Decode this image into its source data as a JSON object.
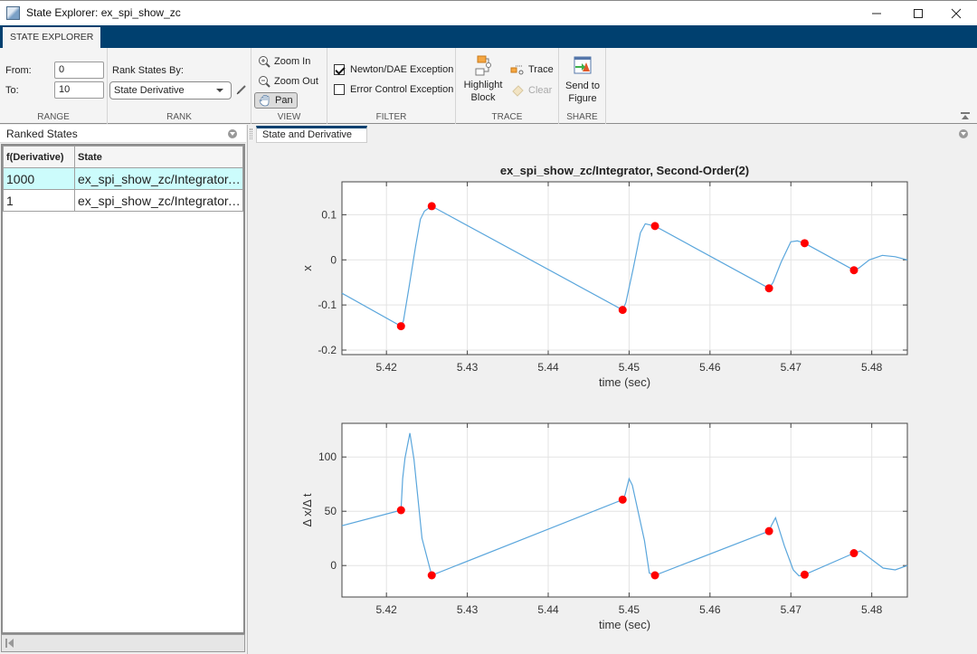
{
  "window": {
    "title": "State Explorer: ex_spi_show_zc",
    "controls": [
      "minimize",
      "maximize",
      "close"
    ]
  },
  "ribbon": {
    "tab_label": "STATE EXPLORER",
    "range": {
      "section_label": "RANGE",
      "from_label": "From:",
      "from_value": "0",
      "to_label": "To:",
      "to_value": "10"
    },
    "rank": {
      "section_label": "RANK",
      "rank_by_label": "Rank States By:",
      "rank_by_value": "State Derivative"
    },
    "view": {
      "section_label": "VIEW",
      "zoom_in": "Zoom In",
      "zoom_out": "Zoom Out",
      "pan": "Pan",
      "pan_active": true
    },
    "filter": {
      "section_label": "FILTER",
      "newton_dae": "Newton/DAE Exception",
      "newton_dae_checked": true,
      "error_control": "Error Control Exception",
      "error_control_checked": false
    },
    "trace": {
      "section_label": "TRACE",
      "highlight_line1": "Highlight",
      "highlight_line2": "Block",
      "trace": "Trace",
      "clear": "Clear"
    },
    "share": {
      "section_label": "SHARE",
      "send_line1": "Send to",
      "send_line2": "Figure"
    }
  },
  "left_panel": {
    "title": "Ranked States",
    "columns": [
      "f(Derivative)",
      "State"
    ],
    "rows": [
      {
        "value": "1000",
        "state": "ex_spi_show_zc/Integrator,…",
        "selected": true
      },
      {
        "value": "1",
        "state": "ex_spi_show_zc/Integrator,…",
        "selected": false
      }
    ]
  },
  "right_panel": {
    "tab_label": "State and Derivative"
  },
  "chart_data": [
    {
      "type": "line",
      "title": "ex_spi_show_zc/Integrator,  Second-Order(2)",
      "xlabel": "time (sec)",
      "ylabel": "x",
      "xlim": [
        5.4145,
        5.4844
      ],
      "ylim": [
        -0.21,
        0.173
      ],
      "xticks": [
        5.42,
        5.43,
        5.44,
        5.45,
        5.46,
        5.47,
        5.48
      ],
      "xtick_labels": [
        "5.42",
        "5.43",
        "5.44",
        "5.45",
        "5.46",
        "5.47",
        "5.48"
      ],
      "yticks": [
        -0.2,
        -0.1,
        0,
        0.1
      ],
      "ytick_labels": [
        "-0.2",
        "-0.1",
        "0",
        "0.1"
      ],
      "grid": true,
      "line_color": "#5aa6dc",
      "marker_color": "#ff0000",
      "series": [
        {
          "name": "state",
          "x": [
            5.4145,
            5.4218,
            5.4221,
            5.4228,
            5.4236,
            5.4242,
            5.4247,
            5.4256,
            5.4492,
            5.4496,
            5.4505,
            5.4514,
            5.452,
            5.4532,
            5.4673,
            5.4678,
            5.4688,
            5.47,
            5.4708,
            5.4717,
            5.4778,
            5.4784,
            5.4797,
            5.4813,
            5.4829,
            5.4844
          ],
          "y": [
            -0.074,
            -0.147,
            -0.135,
            -0.06,
            0.03,
            0.09,
            0.108,
            0.119,
            -0.111,
            -0.095,
            -0.02,
            0.06,
            0.08,
            0.075,
            -0.063,
            -0.05,
            -0.005,
            0.04,
            0.042,
            0.037,
            -0.023,
            -0.018,
            0.0,
            0.01,
            0.007,
            0.0
          ]
        },
        {
          "name": "exceptions",
          "x": [
            5.4218,
            5.4256,
            5.4492,
            5.4532,
            5.4673,
            5.4717,
            5.4778
          ],
          "y": [
            -0.147,
            0.119,
            -0.111,
            0.075,
            -0.063,
            0.037,
            -0.023
          ]
        }
      ]
    },
    {
      "type": "line",
      "title": "",
      "xlabel": "time (sec)",
      "ylabel": "Δ x/Δ t",
      "xlim": [
        5.4145,
        5.4844
      ],
      "ylim": [
        -29,
        131
      ],
      "xticks": [
        5.42,
        5.43,
        5.44,
        5.45,
        5.46,
        5.47,
        5.48
      ],
      "xtick_labels": [
        "5.42",
        "5.43",
        "5.44",
        "5.45",
        "5.46",
        "5.47",
        "5.48"
      ],
      "yticks": [
        0,
        50,
        100
      ],
      "ytick_labels": [
        "0",
        "50",
        "100"
      ],
      "grid": true,
      "line_color": "#5aa6dc",
      "marker_color": "#ff0000",
      "series": [
        {
          "name": "derivative",
          "x": [
            5.4145,
            5.4218,
            5.422,
            5.4223,
            5.4229,
            5.4234,
            5.4244,
            5.4256,
            5.4492,
            5.4495,
            5.45,
            5.4504,
            5.4519,
            5.4525,
            5.4532,
            5.4673,
            5.4676,
            5.4681,
            5.4692,
            5.4703,
            5.471,
            5.4717,
            5.4778,
            5.4786,
            5.4814,
            5.4829,
            5.4844
          ],
          "y": [
            36.7,
            51,
            80,
            99,
            122,
            98,
            25,
            -9,
            60.7,
            65,
            80,
            74,
            23,
            -7,
            -9,
            31.7,
            37,
            44,
            18,
            -4,
            -9.5,
            -8.4,
            11.4,
            13.5,
            -2.3,
            -4,
            0
          ]
        },
        {
          "name": "exceptions",
          "x": [
            5.4218,
            5.4256,
            5.4492,
            5.4532,
            5.4673,
            5.4717,
            5.4778
          ],
          "y": [
            51,
            -9,
            60.7,
            -9,
            31.7,
            -8.4,
            11.4
          ]
        }
      ]
    }
  ]
}
